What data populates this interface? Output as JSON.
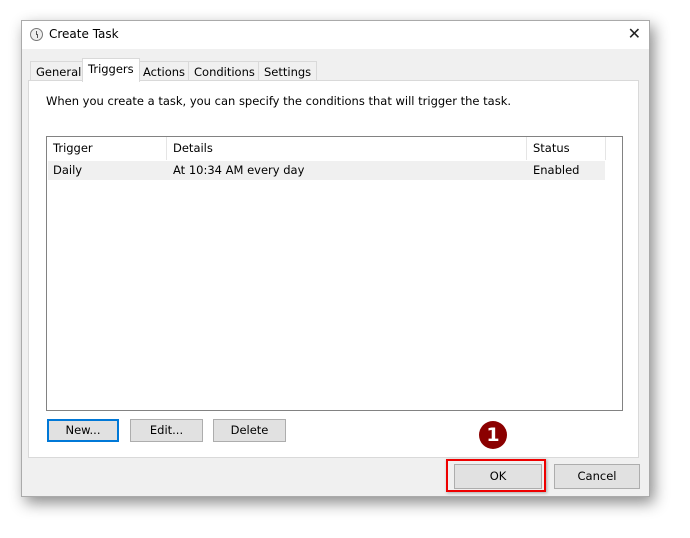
{
  "window": {
    "title": "Create Task",
    "close_icon": "close-icon"
  },
  "tabs": [
    {
      "label": "General"
    },
    {
      "label": "Triggers"
    },
    {
      "label": "Actions"
    },
    {
      "label": "Conditions"
    },
    {
      "label": "Settings"
    }
  ],
  "active_tab": "Triggers",
  "description": "When you create a task, you can specify the conditions that will trigger the task.",
  "table": {
    "columns": [
      "Trigger",
      "Details",
      "Status"
    ],
    "rows": [
      {
        "trigger": "Daily",
        "details": "At 10:34 AM every day",
        "status": "Enabled"
      }
    ]
  },
  "buttons": {
    "new": "New...",
    "edit": "Edit...",
    "delete": "Delete",
    "ok": "OK",
    "cancel": "Cancel"
  },
  "annotation": {
    "step": "1",
    "color": "#8b0000",
    "highlight_color": "#ee0000"
  }
}
